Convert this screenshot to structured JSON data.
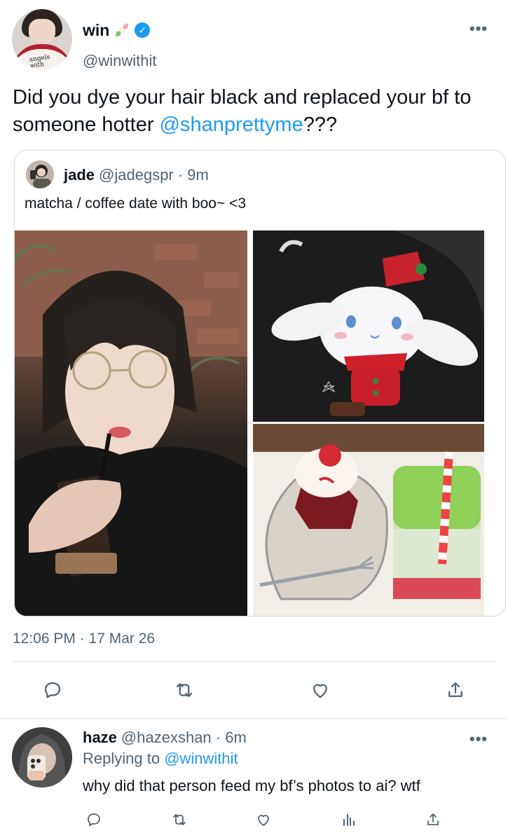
{
  "main_tweet": {
    "display_name": "win",
    "handle": "@winwithit",
    "avatar_shirt_text": "angels with di...",
    "text_before": "Did you dye your hair black and replaced your bf to someone hotter ",
    "mention": "@shanprettyme",
    "text_after": "???",
    "timestamp": "12:06 PM · 17 Mar 26",
    "more": "•••",
    "icons": {
      "emoji": "skewer-emoji",
      "verified": "verified-badge",
      "reply": "reply-icon",
      "retweet": "retweet-icon",
      "like": "heart-icon",
      "share": "share-icon"
    }
  },
  "quote_tweet": {
    "display_name": "jade",
    "handle_time": "@jadegspr · 9m",
    "text": "matcha / coffee date with boo~ <3",
    "photos": [
      "person-drinking-iced-coffee",
      "cinnamoroll-plush-keychain",
      "cupcake-and-matcha-latte"
    ]
  },
  "reply_tweet": {
    "display_name": "haze",
    "handle_time": "@hazexshan · 6m",
    "replying_prefix": "Replying to ",
    "replying_to": "@winwithit",
    "text": "why did that person feed my bf’s photos to ai? wtf",
    "more": "•••",
    "icons": {
      "reply": "reply-icon",
      "retweet": "retweet-icon",
      "like": "heart-icon",
      "views": "analytics-icon",
      "share": "share-icon"
    }
  },
  "colors": {
    "text": "#0f1419",
    "secondary": "#536471",
    "link": "#1d9bf0",
    "border": "#cfd9de"
  }
}
